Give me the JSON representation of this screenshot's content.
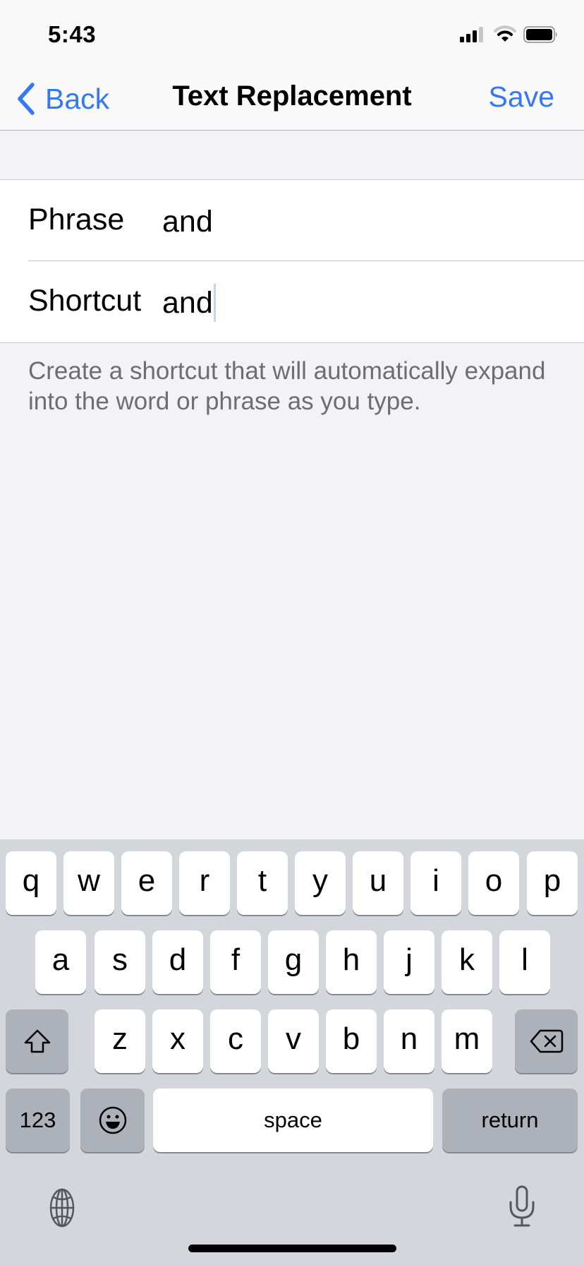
{
  "status_bar": {
    "time": "5:43",
    "icons": [
      "cellular-signal-icon",
      "wifi-icon",
      "battery-icon"
    ],
    "signal_bars": 3,
    "signal_bars_total": 4,
    "battery_level": 1.0
  },
  "nav": {
    "back_label": "Back",
    "title": "Text Replacement",
    "save_label": "Save",
    "accent_color": "#3478f6"
  },
  "form": {
    "phrase": {
      "label": "Phrase",
      "value": "and"
    },
    "shortcut": {
      "label": "Shortcut",
      "value": "and"
    },
    "footer": "Create a shortcut that will automatically expand into the word or phrase as you type."
  },
  "keyboard": {
    "rows": [
      [
        "q",
        "w",
        "e",
        "r",
        "t",
        "y",
        "u",
        "i",
        "o",
        "p"
      ],
      [
        "a",
        "s",
        "d",
        "f",
        "g",
        "h",
        "j",
        "k",
        "l"
      ],
      [
        "z",
        "x",
        "c",
        "v",
        "b",
        "n",
        "m"
      ]
    ],
    "shift_icon": "shift-icon",
    "delete_icon": "delete-backward-icon",
    "numbers_label": "123",
    "emoji_icon": "emoji-icon",
    "space_label": "space",
    "return_label": "return",
    "globe_icon": "globe-icon",
    "mic_icon": "microphone-icon"
  }
}
